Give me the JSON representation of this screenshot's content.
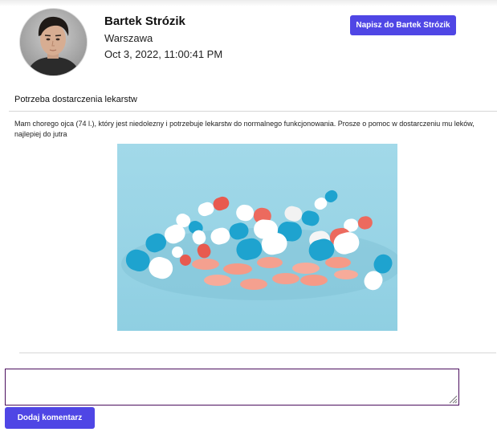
{
  "author": {
    "name": "Bartek Strózik",
    "city": "Warszawa",
    "date": "Oct 3, 2022, 11:00:41 PM"
  },
  "actions": {
    "message_label": "Napisz do Bartek Strózik",
    "comment_label": "Dodaj komentarz"
  },
  "post": {
    "title": "Potrzeba dostarczenia lekarstw",
    "body": "Mam chorego ojca (74 l.), który jest niedolezny i potrzebuje lekarstw do normalnego funkcjonowania. Prosze o pomoc w dostarczeniu mu leków, najlepiej do jutra",
    "image_icon": "medicine-pills-photo"
  },
  "comment": {
    "value": "",
    "placeholder": ""
  },
  "colors": {
    "accent": "#4f46e5",
    "comment_border": "#4b0f5e",
    "divider": "#d6d6d6",
    "photo_background": "#9bd6e6",
    "pill_blue": "#1ea3cf",
    "pill_red": "#ec6a5e",
    "tablet_pink": "#f4a08f"
  }
}
